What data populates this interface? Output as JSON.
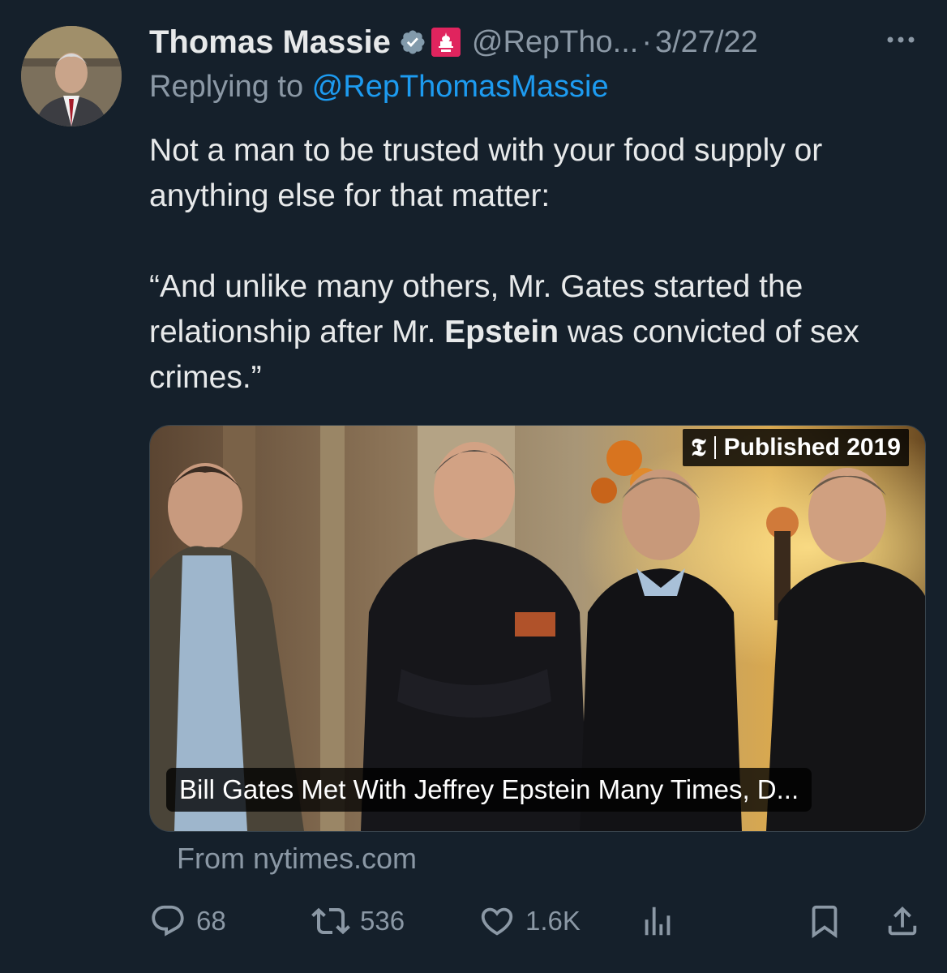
{
  "tweet": {
    "author_name": "Thomas Massie",
    "handle": "@RepTho...",
    "separator": "·",
    "date": "3/27/22",
    "replying_prefix": "Replying to ",
    "replying_to": "@RepThomasMassie",
    "text_line1": "Not a man to be trusted with your food supply or anything else for that matter:",
    "quote_part1": "“And unlike many others, Mr. Gates started the relationship after Mr. ",
    "quote_bold": "Epstein",
    "quote_part2": " was convicted of sex crimes.”"
  },
  "card": {
    "publisher_glyph": "𝕿",
    "published_label": "Published 2019",
    "title": "Bill Gates Met With Jeffrey Epstein Many Times, D...",
    "source": "From nytimes.com"
  },
  "actions": {
    "replies": "68",
    "retweets": "536",
    "likes": "1.6K"
  },
  "colors": {
    "background": "#15202b",
    "text": "#e7e9ea",
    "muted": "#8b98a5",
    "link": "#1d9bf0",
    "verified": "#829aab",
    "gov_badge": "#e0245e"
  },
  "icons": [
    "more-icon",
    "verified-icon",
    "government-badge-icon",
    "reply-icon",
    "retweet-icon",
    "like-icon",
    "views-icon",
    "bookmark-icon",
    "share-icon"
  ]
}
